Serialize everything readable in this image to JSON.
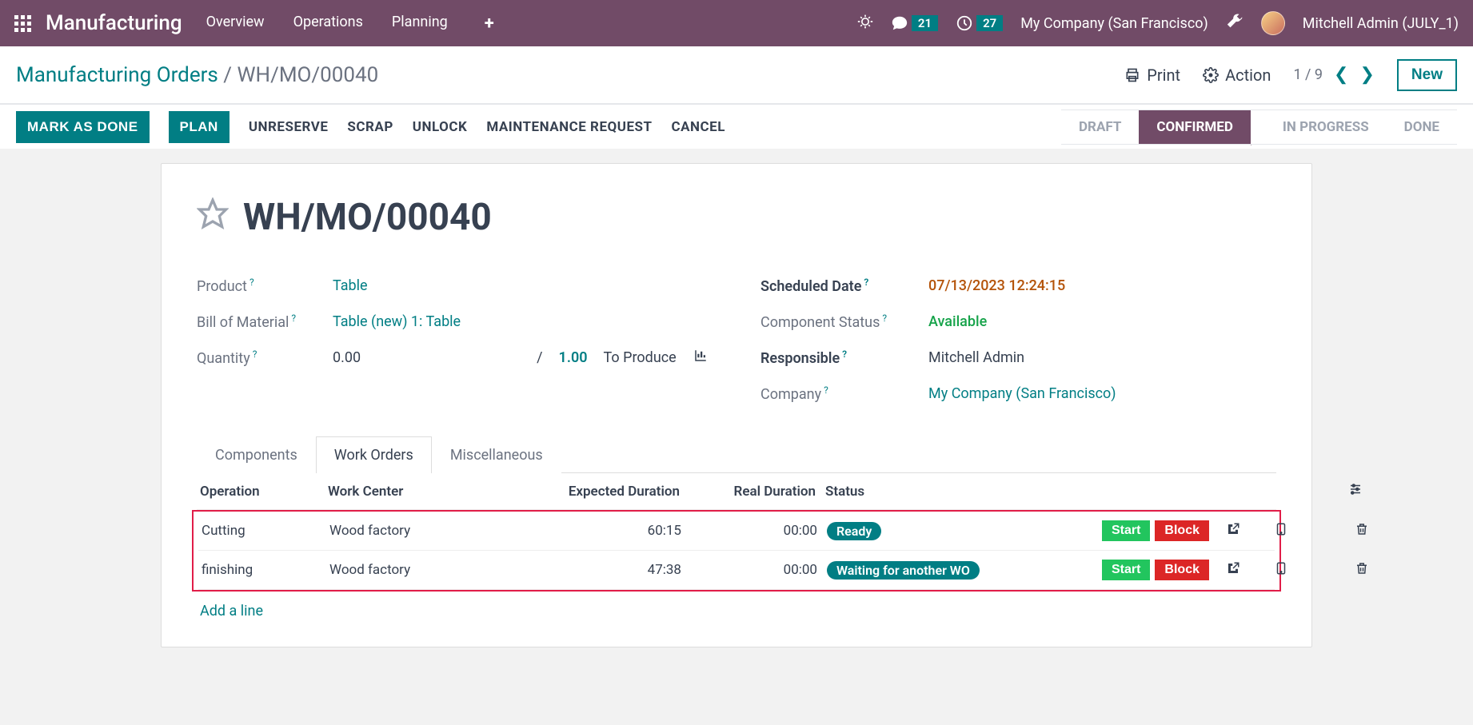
{
  "topbar": {
    "app_title": "Manufacturing",
    "menu": {
      "overview": "Overview",
      "operations": "Operations",
      "planning": "Planning"
    },
    "msg_count": "21",
    "activity_count": "27",
    "company": "My Company (San Francisco)",
    "user": "Mitchell Admin (JULY_1)"
  },
  "breadcrumb": {
    "root": "Manufacturing Orders",
    "sep": " / ",
    "current": "WH/MO/00040"
  },
  "controls": {
    "print": "Print",
    "action": "Action",
    "pager": "1 / 9",
    "new": "New"
  },
  "actions": {
    "mark_done": "MARK AS DONE",
    "plan": "PLAN",
    "unreserve": "UNRESERVE",
    "scrap": "SCRAP",
    "unlock": "UNLOCK",
    "maintenance": "MAINTENANCE REQUEST",
    "cancel": "CANCEL"
  },
  "status_steps": {
    "draft": "DRAFT",
    "confirmed": "CONFIRMED",
    "in_progress": "IN PROGRESS",
    "done": "DONE"
  },
  "form": {
    "title": "WH/MO/00040",
    "labels": {
      "product": "Product",
      "bom": "Bill of Material",
      "quantity": "Quantity",
      "scheduled": "Scheduled Date",
      "comp_status": "Component Status",
      "responsible": "Responsible",
      "company": "Company"
    },
    "values": {
      "product": "Table",
      "bom": "Table (new) 1: Table",
      "qty_val": "0.00",
      "qty_slash": "/",
      "qty_target": "1.00",
      "qty_unit": "To Produce",
      "scheduled": "07/13/2023 12:24:15",
      "comp_status": "Available",
      "responsible": "Mitchell Admin",
      "company": "My Company (San Francisco)"
    }
  },
  "tabs": {
    "components": "Components",
    "work_orders": "Work Orders",
    "misc": "Miscellaneous"
  },
  "table": {
    "headers": {
      "operation": "Operation",
      "work_center": "Work Center",
      "expected": "Expected Duration",
      "real": "Real Duration",
      "status": "Status"
    },
    "rows": [
      {
        "operation": "Cutting",
        "work_center": "Wood factory",
        "expected": "60:15",
        "real": "00:00",
        "status": "Ready",
        "status_class": "pill-ready"
      },
      {
        "operation": "finishing",
        "work_center": "Wood factory",
        "expected": "47:38",
        "real": "00:00",
        "status": "Waiting for another WO",
        "status_class": "pill-wait"
      }
    ],
    "start": "Start",
    "block": "Block",
    "add_line": "Add a line"
  }
}
